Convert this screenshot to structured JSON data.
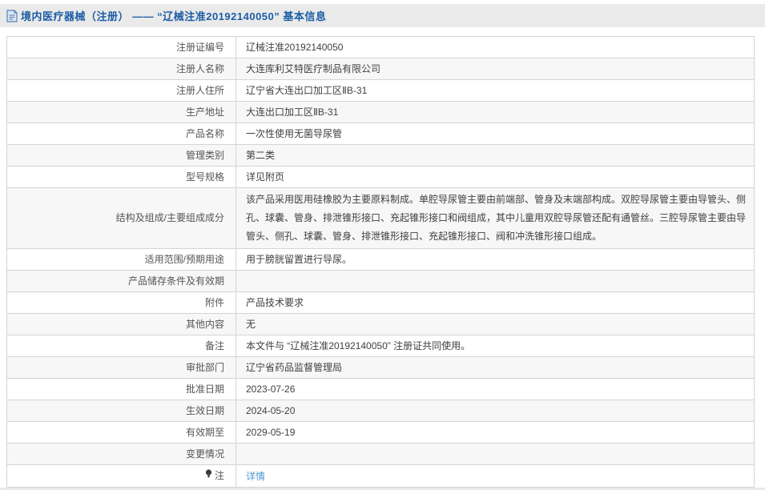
{
  "header": {
    "title": "境内医疗器械（注册） —— “辽械注准20192140050” 基本信息",
    "icon": "document-icon"
  },
  "table": {
    "rows": [
      {
        "label": "注册证编号",
        "value": "辽械注准20192140050"
      },
      {
        "label": "注册人名称",
        "value": "大连库利艾特医疗制品有限公司"
      },
      {
        "label": "注册人住所",
        "value": "辽宁省大连出口加工区ⅡB-31"
      },
      {
        "label": "生产地址",
        "value": "大连出口加工区ⅡB-31"
      },
      {
        "label": "产品名称",
        "value": "一次性使用无菌导尿管"
      },
      {
        "label": "管理类别",
        "value": "第二类"
      },
      {
        "label": "型号规格",
        "value": "详见附页"
      },
      {
        "label": "结构及组成/主要组成成分",
        "value": "该产品采用医用硅橡胶为主要原料制成。单腔导尿管主要由前端部、管身及末端部构成。双腔导尿管主要由导管头、侧孔、球囊、管身、排泄锥形接口、充起锥形接口和阀组成，其中儿童用双腔导尿管还配有通管丝。三腔导尿管主要由导管头、侧孔、球囊、管身、排泄锥形接口、充起锥形接口、阀和冲洗锥形接口组成。",
        "tall": true
      },
      {
        "label": "适用范围/预期用途",
        "value": "用于膀胱留置进行导尿。"
      },
      {
        "label": "产品储存条件及有效期",
        "value": ""
      },
      {
        "label": "附件",
        "value": "产品技术要求"
      },
      {
        "label": "其他内容",
        "value": "无"
      },
      {
        "label": "备注",
        "value": "本文件与 “辽械注准20192140050” 注册证共同使用。"
      },
      {
        "label": "审批部门",
        "value": "辽宁省药品监督管理局"
      },
      {
        "label": "批准日期",
        "value": "2023-07-26"
      },
      {
        "label": "生效日期",
        "value": "2024-05-20"
      },
      {
        "label": "有效期至",
        "value": "2029-05-19"
      },
      {
        "label": "变更情况",
        "value": ""
      },
      {
        "label": "注",
        "label_icon": "bulb-icon",
        "value": "详情",
        "value_type": "link"
      }
    ]
  },
  "colors": {
    "title_blue": "#1c5da5",
    "link_blue": "#4a96d2",
    "band_gray": "#eaeaea",
    "row_alt_gray": "#f7f7f7",
    "border_gray": "#d4d4d4",
    "label_text": "#555555",
    "value_text": "#404040"
  }
}
